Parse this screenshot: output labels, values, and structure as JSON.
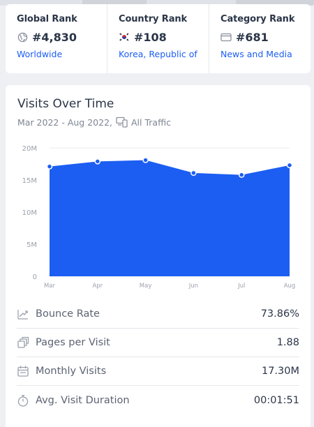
{
  "ranks": [
    {
      "title": "Global Rank",
      "value": "#4,830",
      "link": "Worldwide",
      "icon": "globe-icon"
    },
    {
      "title": "Country Rank",
      "value": "#108",
      "link": "Korea, Republic of",
      "icon": "korea-flag-icon"
    },
    {
      "title": "Category Rank",
      "value": "#681",
      "link": "News and Media",
      "icon": "category-card-icon"
    }
  ],
  "visits": {
    "title": "Visits Over Time",
    "date_range": "Mar 2022 - Aug 2022,",
    "traffic_type": "All Traffic"
  },
  "chart_data": {
    "type": "area",
    "categories": [
      "Mar",
      "Apr",
      "May",
      "Jun",
      "Jul",
      "Aug"
    ],
    "values": [
      17.1,
      17.9,
      18.1,
      16.1,
      15.8,
      17.3
    ],
    "ylim": [
      0,
      20
    ],
    "yticks": [
      "0",
      "5M",
      "10M",
      "15M",
      "20M"
    ],
    "grid": true,
    "fill_color": "#1c5ef2"
  },
  "metrics": [
    {
      "label": "Bounce Rate",
      "value": "73.86%",
      "icon": "bounce-rate-icon"
    },
    {
      "label": "Pages per Visit",
      "value": "1.88",
      "icon": "pages-icon"
    },
    {
      "label": "Monthly Visits",
      "value": "17.30M",
      "icon": "calendar-icon"
    },
    {
      "label": "Avg. Visit Duration",
      "value": "00:01:51",
      "icon": "stopwatch-icon"
    }
  ]
}
